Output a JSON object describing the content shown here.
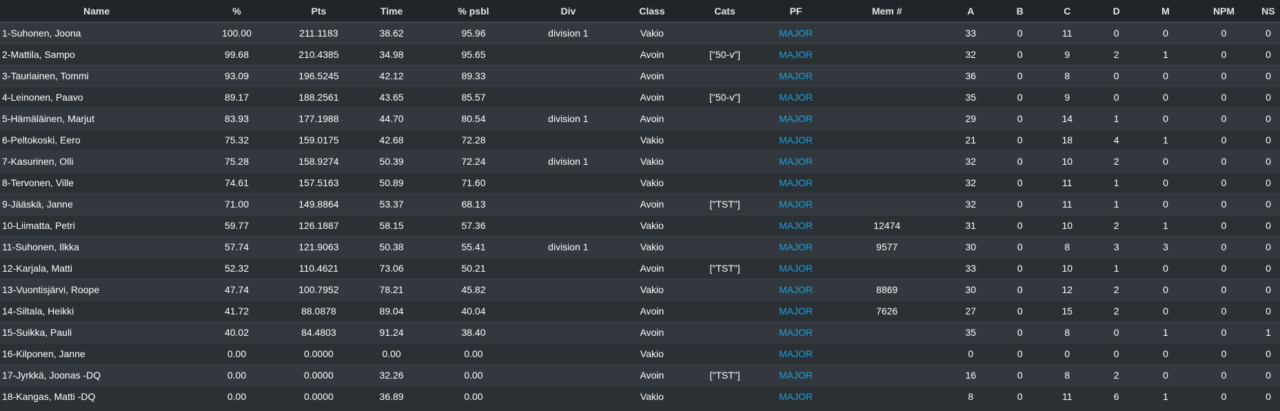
{
  "table": {
    "headers": {
      "name": "Name",
      "pct": "%",
      "pts": "Pts",
      "time": "Time",
      "pct_psbl": "% psbl",
      "div": "Div",
      "class": "Class",
      "cats": "Cats",
      "pf": "PF",
      "mem": "Mem #",
      "a": "A",
      "b": "B",
      "c": "C",
      "d": "D",
      "m": "M",
      "npm": "NPM",
      "ns": "NS"
    },
    "rows": [
      {
        "name": "1-Suhonen, Joona",
        "pct": "100.00",
        "pts": "211.1183",
        "time": "38.62",
        "pct_psbl": "95.96",
        "div": "division 1",
        "class": "Vakio",
        "cats": "",
        "pf": "MAJOR",
        "mem": "",
        "a": "33",
        "b": "0",
        "c": "11",
        "d": "0",
        "m": "0",
        "npm": "0",
        "ns": "0"
      },
      {
        "name": "2-Mattila, Sampo",
        "pct": "99.68",
        "pts": "210.4385",
        "time": "34.98",
        "pct_psbl": "95.65",
        "div": "",
        "class": "Avoin",
        "cats": "[\"50-v\"]",
        "pf": "MAJOR",
        "mem": "",
        "a": "32",
        "b": "0",
        "c": "9",
        "d": "2",
        "m": "1",
        "npm": "0",
        "ns": "0"
      },
      {
        "name": "3-Tauriainen, Tommi",
        "pct": "93.09",
        "pts": "196.5245",
        "time": "42.12",
        "pct_psbl": "89.33",
        "div": "",
        "class": "Avoin",
        "cats": "",
        "pf": "MAJOR",
        "mem": "",
        "a": "36",
        "b": "0",
        "c": "8",
        "d": "0",
        "m": "0",
        "npm": "0",
        "ns": "0"
      },
      {
        "name": "4-Leinonen, Paavo",
        "pct": "89.17",
        "pts": "188.2561",
        "time": "43.65",
        "pct_psbl": "85.57",
        "div": "",
        "class": "Avoin",
        "cats": "[\"50-v\"]",
        "pf": "MAJOR",
        "mem": "",
        "a": "35",
        "b": "0",
        "c": "9",
        "d": "0",
        "m": "0",
        "npm": "0",
        "ns": "0"
      },
      {
        "name": "5-Hämäläinen, Marjut",
        "pct": "83.93",
        "pts": "177.1988",
        "time": "44.70",
        "pct_psbl": "80.54",
        "div": "division 1",
        "class": "Avoin",
        "cats": "",
        "pf": "MAJOR",
        "mem": "",
        "a": "29",
        "b": "0",
        "c": "14",
        "d": "1",
        "m": "0",
        "npm": "0",
        "ns": "0"
      },
      {
        "name": "6-Peltokoski, Eero",
        "pct": "75.32",
        "pts": "159.0175",
        "time": "42.68",
        "pct_psbl": "72.28",
        "div": "",
        "class": "Vakio",
        "cats": "",
        "pf": "MAJOR",
        "mem": "",
        "a": "21",
        "b": "0",
        "c": "18",
        "d": "4",
        "m": "1",
        "npm": "0",
        "ns": "0"
      },
      {
        "name": "7-Kasurinen, Olli",
        "pct": "75.28",
        "pts": "158.9274",
        "time": "50.39",
        "pct_psbl": "72.24",
        "div": "division 1",
        "class": "Vakio",
        "cats": "",
        "pf": "MAJOR",
        "mem": "",
        "a": "32",
        "b": "0",
        "c": "10",
        "d": "2",
        "m": "0",
        "npm": "0",
        "ns": "0"
      },
      {
        "name": "8-Tervonen, Ville",
        "pct": "74.61",
        "pts": "157.5163",
        "time": "50.89",
        "pct_psbl": "71.60",
        "div": "",
        "class": "Vakio",
        "cats": "",
        "pf": "MAJOR",
        "mem": "",
        "a": "32",
        "b": "0",
        "c": "11",
        "d": "1",
        "m": "0",
        "npm": "0",
        "ns": "0"
      },
      {
        "name": "9-Jääskä, Janne",
        "pct": "71.00",
        "pts": "149.8864",
        "time": "53.37",
        "pct_psbl": "68.13",
        "div": "",
        "class": "Avoin",
        "cats": "[\"TST\"]",
        "pf": "MAJOR",
        "mem": "",
        "a": "32",
        "b": "0",
        "c": "11",
        "d": "1",
        "m": "0",
        "npm": "0",
        "ns": "0"
      },
      {
        "name": "10-Liimatta, Petri",
        "pct": "59.77",
        "pts": "126.1887",
        "time": "58.15",
        "pct_psbl": "57.36",
        "div": "",
        "class": "Vakio",
        "cats": "",
        "pf": "MAJOR",
        "mem": "12474",
        "a": "31",
        "b": "0",
        "c": "10",
        "d": "2",
        "m": "1",
        "npm": "0",
        "ns": "0"
      },
      {
        "name": "11-Suhonen, Ilkka",
        "pct": "57.74",
        "pts": "121.9063",
        "time": "50.38",
        "pct_psbl": "55.41",
        "div": "division 1",
        "class": "Vakio",
        "cats": "",
        "pf": "MAJOR",
        "mem": "9577",
        "a": "30",
        "b": "0",
        "c": "8",
        "d": "3",
        "m": "3",
        "npm": "0",
        "ns": "0"
      },
      {
        "name": "12-Karjala, Matti",
        "pct": "52.32",
        "pts": "110.4621",
        "time": "73.06",
        "pct_psbl": "50.21",
        "div": "",
        "class": "Avoin",
        "cats": "[\"TST\"]",
        "pf": "MAJOR",
        "mem": "",
        "a": "33",
        "b": "0",
        "c": "10",
        "d": "1",
        "m": "0",
        "npm": "0",
        "ns": "0"
      },
      {
        "name": "13-Vuontisjärvi, Roope",
        "pct": "47.74",
        "pts": "100.7952",
        "time": "78.21",
        "pct_psbl": "45.82",
        "div": "",
        "class": "Vakio",
        "cats": "",
        "pf": "MAJOR",
        "mem": "8869",
        "a": "30",
        "b": "0",
        "c": "12",
        "d": "2",
        "m": "0",
        "npm": "0",
        "ns": "0"
      },
      {
        "name": "14-Siltala, Heikki",
        "pct": "41.72",
        "pts": "88.0878",
        "time": "89.04",
        "pct_psbl": "40.04",
        "div": "",
        "class": "Avoin",
        "cats": "",
        "pf": "MAJOR",
        "mem": "7626",
        "a": "27",
        "b": "0",
        "c": "15",
        "d": "2",
        "m": "0",
        "npm": "0",
        "ns": "0"
      },
      {
        "name": "15-Suikka, Pauli",
        "pct": "40.02",
        "pts": "84.4803",
        "time": "91.24",
        "pct_psbl": "38.40",
        "div": "",
        "class": "Avoin",
        "cats": "",
        "pf": "MAJOR",
        "mem": "",
        "a": "35",
        "b": "0",
        "c": "8",
        "d": "0",
        "m": "1",
        "npm": "0",
        "ns": "1"
      },
      {
        "name": "16-Kilponen, Janne",
        "pct": "0.00",
        "pts": "0.0000",
        "time": "0.00",
        "pct_psbl": "0.00",
        "div": "",
        "class": "Vakio",
        "cats": "",
        "pf": "MAJOR",
        "mem": "",
        "a": "0",
        "b": "0",
        "c": "0",
        "d": "0",
        "m": "0",
        "npm": "0",
        "ns": "0"
      },
      {
        "name": "17-Jyrkkä, Joonas -DQ",
        "pct": "0.00",
        "pts": "0.0000",
        "time": "32.26",
        "pct_psbl": "0.00",
        "div": "",
        "class": "Avoin",
        "cats": "[\"TST\"]",
        "pf": "MAJOR",
        "mem": "",
        "a": "16",
        "b": "0",
        "c": "8",
        "d": "2",
        "m": "0",
        "npm": "0",
        "ns": "0"
      },
      {
        "name": "18-Kangas, Matti -DQ",
        "pct": "0.00",
        "pts": "0.0000",
        "time": "36.89",
        "pct_psbl": "0.00",
        "div": "",
        "class": "Vakio",
        "cats": "",
        "pf": "MAJOR",
        "mem": "",
        "a": "8",
        "b": "0",
        "c": "11",
        "d": "6",
        "m": "1",
        "npm": "0",
        "ns": "0"
      }
    ]
  }
}
